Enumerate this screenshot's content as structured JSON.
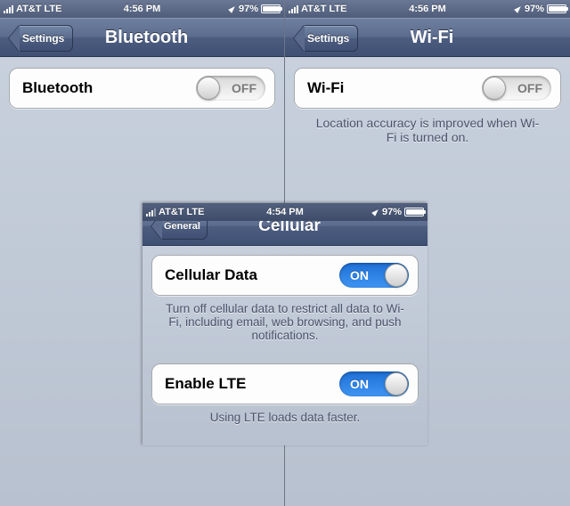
{
  "left": {
    "status": {
      "carrier": "AT&T",
      "net": "LTE",
      "time": "4:56 PM",
      "battery": "97%",
      "battery_fill": "97%"
    },
    "nav": {
      "back": "Settings",
      "title": "Bluetooth"
    },
    "row": {
      "label": "Bluetooth",
      "toggle": "OFF"
    }
  },
  "right": {
    "status": {
      "carrier": "AT&T",
      "net": "LTE",
      "time": "4:56 PM",
      "battery": "97%",
      "battery_fill": "97%"
    },
    "nav": {
      "back": "Settings",
      "title": "Wi-Fi"
    },
    "row": {
      "label": "Wi-Fi",
      "toggle": "OFF"
    },
    "footer": "Location accuracy is improved when Wi-Fi is turned on."
  },
  "center": {
    "status": {
      "carrier": "AT&T",
      "net": "LTE",
      "time": "4:54 PM",
      "battery": "97%",
      "battery_fill": "97%"
    },
    "nav": {
      "back": "General",
      "title": "Cellular"
    },
    "row1": {
      "label": "Cellular Data",
      "toggle": "ON"
    },
    "footer1": "Turn off cellular data to restrict all data to Wi-Fi, including email, web browsing, and push notifications.",
    "row2": {
      "label": "Enable LTE",
      "toggle": "ON"
    },
    "footer2": "Using LTE loads data faster."
  }
}
